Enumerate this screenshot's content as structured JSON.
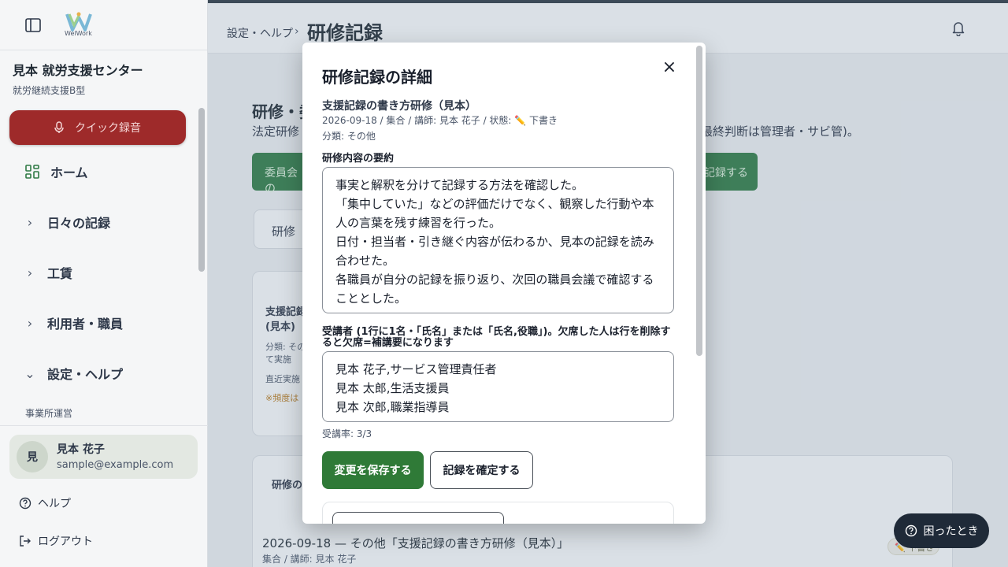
{
  "sidebar": {
    "logo_text": "WelWork",
    "org_name": "見本 就労支援センター",
    "org_type": "就労継続支援B型",
    "quick_record": "クイック録音",
    "nav": {
      "home": "ホーム",
      "daily": "日々の記録",
      "wages": "工賃",
      "users_staff": "利用者・職員",
      "settings_help": "設定・ヘルプ",
      "office_ops": "事業所運営"
    },
    "user": {
      "initial": "見",
      "name": "見本 花子",
      "email": "sample@example.com"
    },
    "help": "ヘルプ",
    "logout": "ログアウト"
  },
  "header": {
    "breadcrumb": "設定・ヘルプ",
    "separator": "›",
    "title": "研修記録"
  },
  "page": {
    "section_title": "研修・委",
    "section_desc": "法定研修",
    "section_desc_right": "最終判断は管理者・サビ管)。",
    "btn_left": "委員会の",
    "btn_right": "記録する",
    "tab_label": "研修",
    "card": {
      "title_line1": "支援記録",
      "title_line2": "(見本)",
      "category_line1": "分類: その",
      "category_line2": "て実施",
      "recent": "直近実施",
      "frequency_note": "※頻度は"
    },
    "list": {
      "heading": "研修の",
      "row_title": "2026-09-18 — その他「支援記録の書き方研修（見本）」",
      "row_sub": "集合 / 講師: 見本 花子",
      "row_badge": "✏️ 下書き"
    }
  },
  "help_fab": "困ったとき",
  "modal": {
    "title": "研修記録の詳細",
    "record_title": "支援記録の書き方研修（見本）",
    "meta": "2026-09-18 / 集合 / 講師: 見本 花子 / 状態: ✏️ 下書き",
    "category": "分類: その他",
    "summary_label": "研修内容の要約",
    "summary_value": "事実と解釈を分けて記録する方法を確認した。\n「集中していた」などの評価だけでなく、観察した行動や本人の言葉を残す練習を行った。\n日付・担当者・引き継ぐ内容が伝わるか、見本の記録を読み合わせた。\n各職員が自分の記録を振り返り、次回の職員会議で確認することとした。",
    "attendees_label": "受講者 (1行に1名・「氏名」または「氏名,役職」)。欠席した人は行を削除すると欠席=補講要になります",
    "attendees_value": "見本 花子,サービス管理責任者\n見本 太郎,生活支援員\n見本 次郎,職業指導員",
    "attendance_rate": "受講率: 3/3",
    "save_button": "変更を保存する",
    "confirm_button": "記録を確定する",
    "close_icon": "close-icon"
  }
}
